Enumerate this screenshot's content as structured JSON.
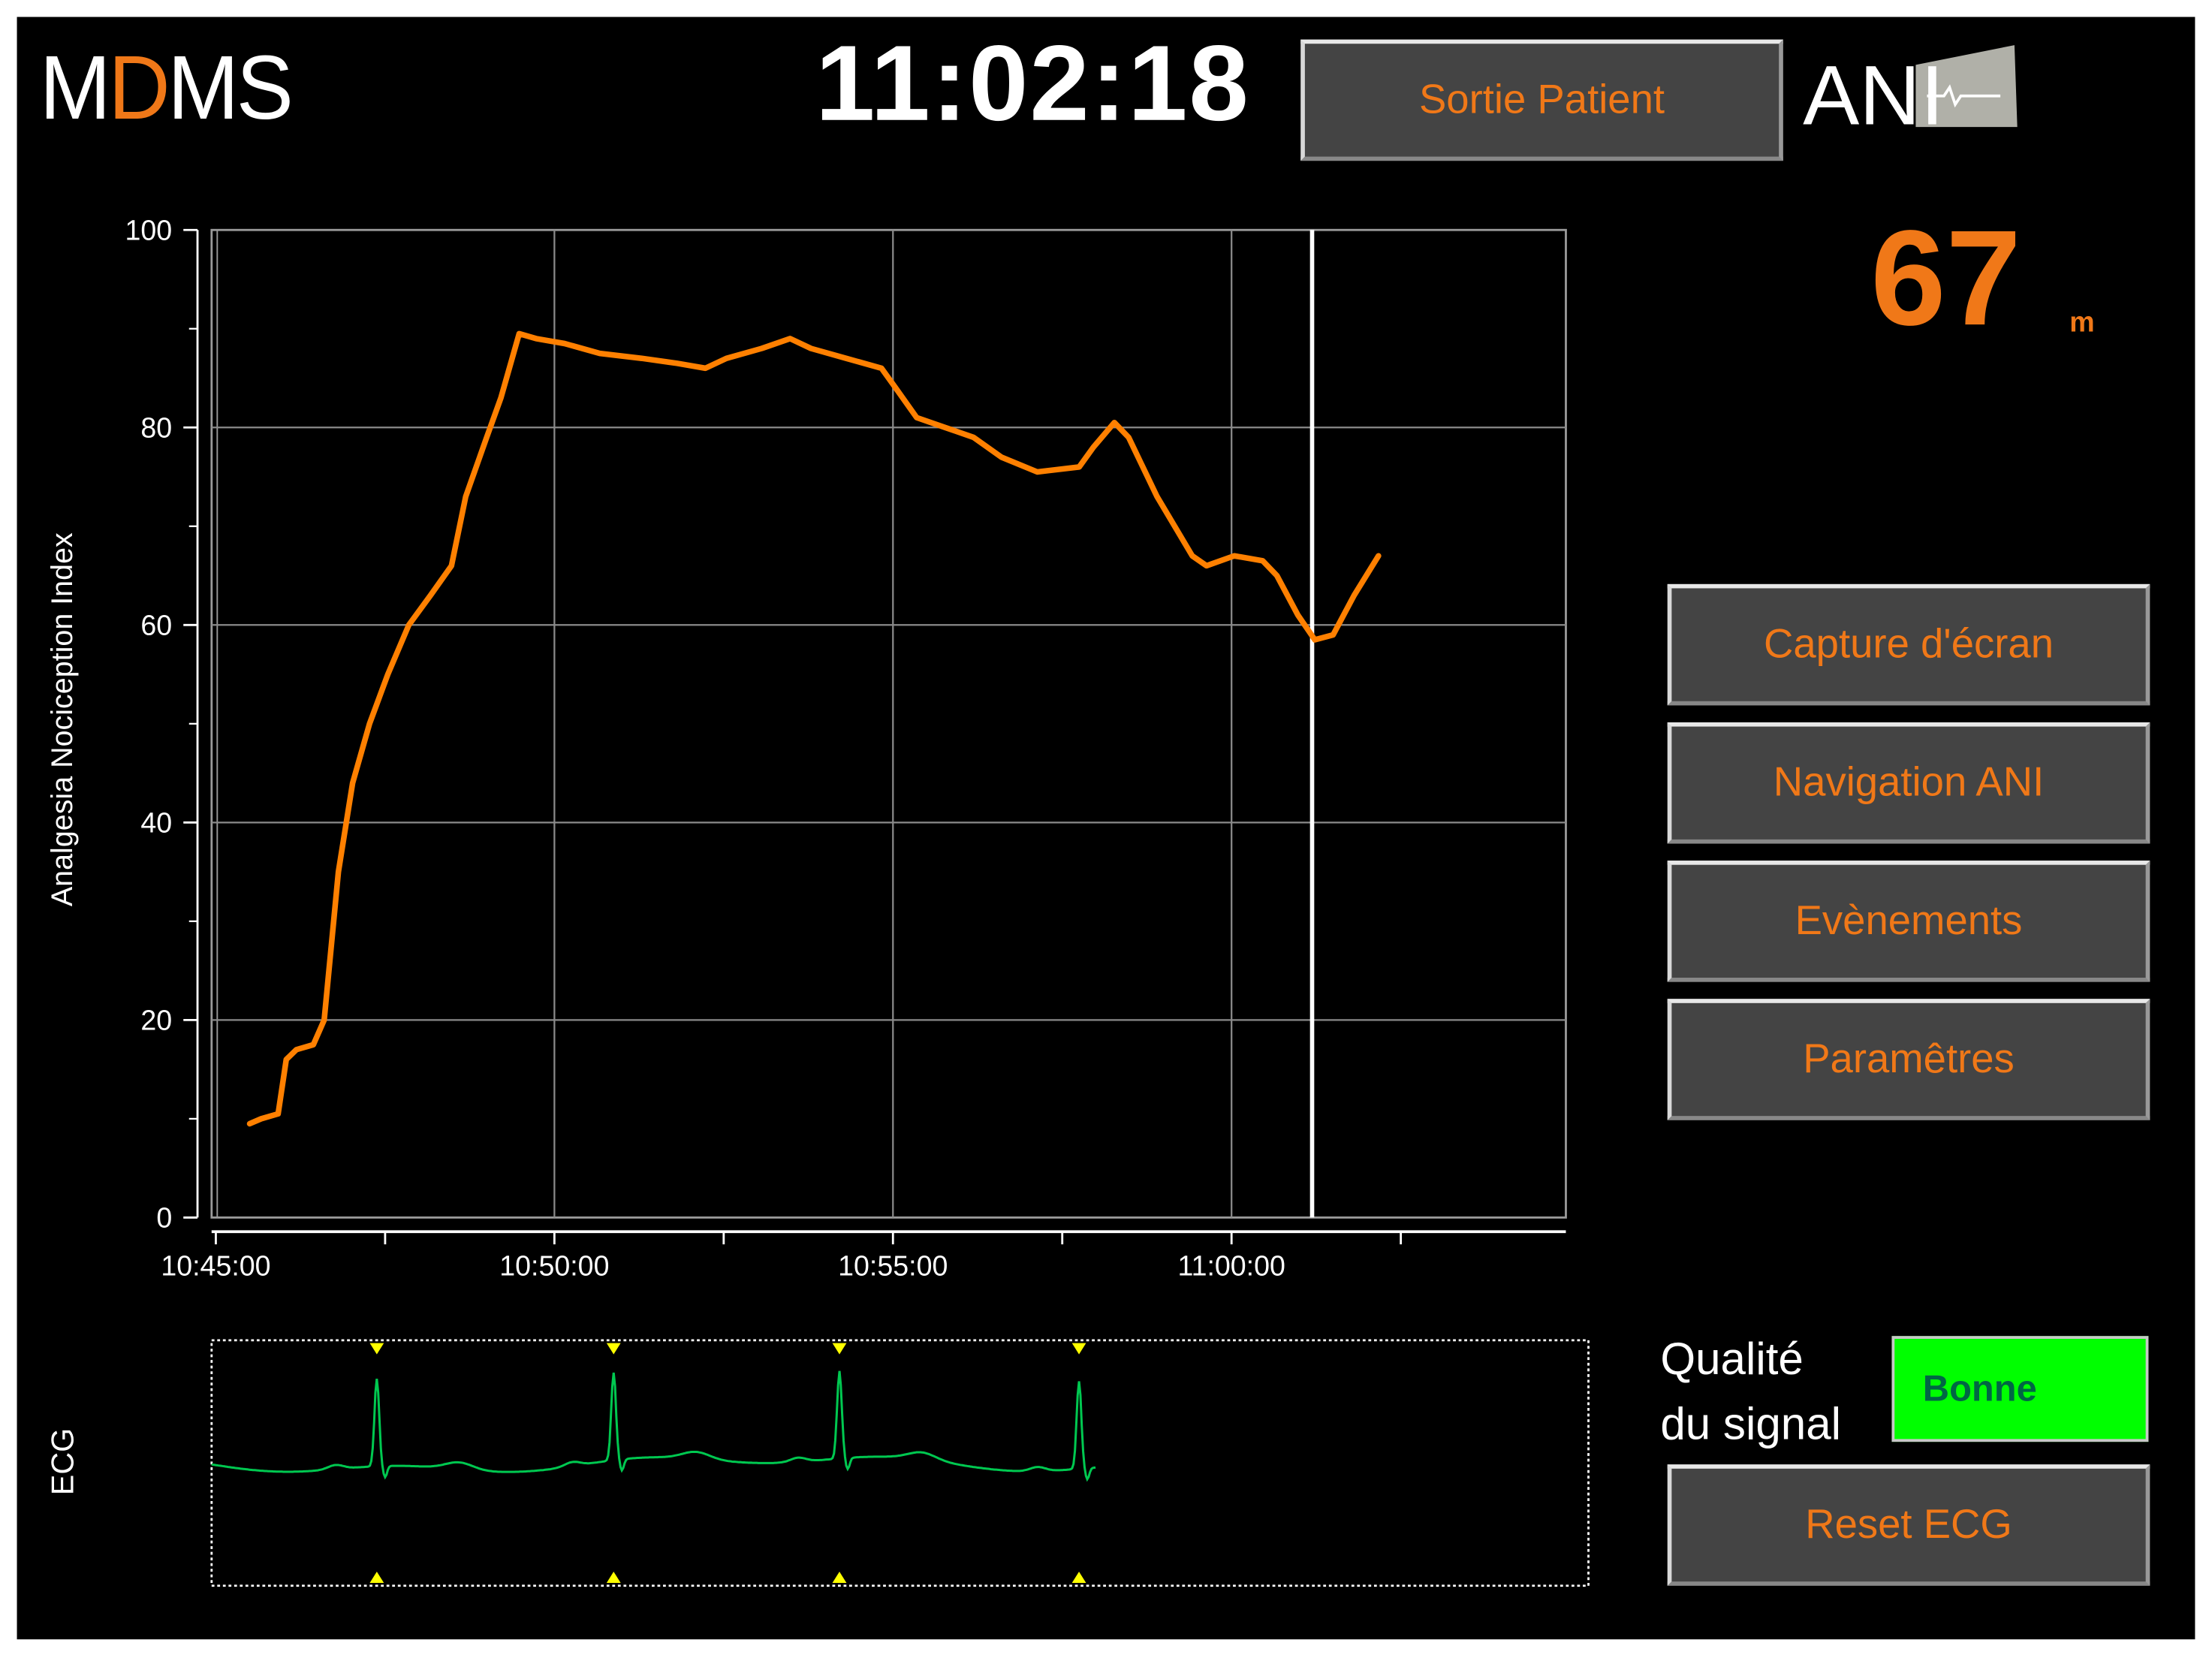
{
  "header": {
    "logo_text_left": "M",
    "logo_text_accent": "D",
    "logo_text_right": "MS",
    "clock": "11:02:18",
    "exit_button": "Sortie Patient",
    "ani_logo_text": "ANI"
  },
  "current_value": {
    "value": "67",
    "unit": "m"
  },
  "side_buttons": [
    {
      "label": "Capture d'écran"
    },
    {
      "label": "Navigation ANI"
    },
    {
      "label": "Evènements"
    },
    {
      "label": "Paramêtres"
    }
  ],
  "signal_quality": {
    "label_line1": "Qualité",
    "label_line2": "du signal",
    "status": "Bonne",
    "status_color": "#00ff00"
  },
  "reset_button": "Reset ECG",
  "ecg": {
    "label": "ECG",
    "sweep_seconds": 5,
    "beat_times_s": [
      0.6,
      1.46,
      2.28,
      3.15
    ],
    "trace_end_s": 3.21,
    "color": "#00c850",
    "marker_color": "#ffff00"
  },
  "chart_data": {
    "type": "line",
    "title": "",
    "ylabel": "Analgesia Nociception Index",
    "xlabel": "",
    "ylim": [
      0,
      100
    ],
    "yticks": [
      0,
      20,
      40,
      60,
      80,
      100
    ],
    "x_unit": "minutes after 10:45:00",
    "xlim": [
      0,
      20
    ],
    "xtick_labels": [
      {
        "x": 0,
        "label": "10:45:00"
      },
      {
        "x": 5,
        "label": "10:50:00"
      },
      {
        "x": 10,
        "label": "10:55:00"
      },
      {
        "x": 15,
        "label": "11:00:00"
      }
    ],
    "minor_xticks": [
      2.5,
      7.5,
      12.5,
      17.5
    ],
    "grid": true,
    "cursor_x": 16.19,
    "series": [
      {
        "name": "ANI",
        "color": "#ff8000",
        "x": [
          0.5,
          0.67,
          0.92,
          1.04,
          1.19,
          1.44,
          1.6,
          1.81,
          2.02,
          2.27,
          2.54,
          2.85,
          3.17,
          3.48,
          3.69,
          4.0,
          4.21,
          4.48,
          4.73,
          5.15,
          5.67,
          6.29,
          6.81,
          7.23,
          7.54,
          8.06,
          8.48,
          8.79,
          9.31,
          9.83,
          10.04,
          10.35,
          10.77,
          11.19,
          11.6,
          12.13,
          12.75,
          12.96,
          13.27,
          13.48,
          13.9,
          14.42,
          14.63,
          15.04,
          15.46,
          15.67,
          15.98,
          16.23,
          16.5,
          16.81,
          17.17
        ],
        "y": [
          9.5,
          10,
          10.5,
          16,
          17,
          17.5,
          20,
          35,
          44,
          50,
          55,
          60,
          63,
          66,
          73,
          79,
          83,
          89.5,
          89,
          88.5,
          87.5,
          87,
          86.5,
          86,
          87,
          88,
          89,
          88,
          87,
          86,
          84,
          81,
          80,
          79,
          77,
          75.5,
          76,
          78,
          80.5,
          79,
          73,
          67,
          66,
          67,
          66.5,
          65,
          61,
          58.5,
          59,
          63,
          67
        ]
      }
    ]
  }
}
